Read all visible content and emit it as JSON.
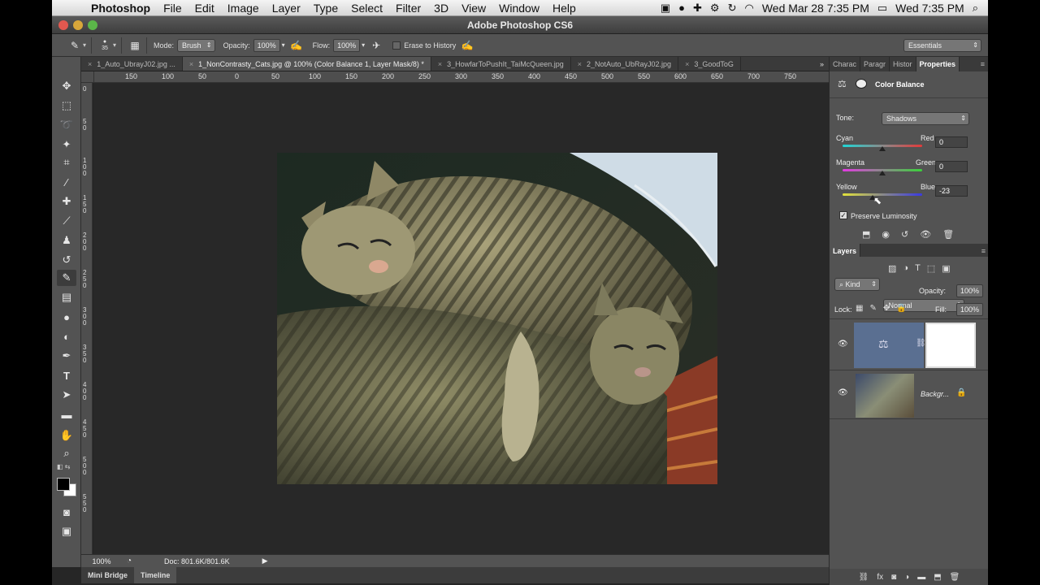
{
  "menubar": {
    "app": "Photoshop",
    "items": [
      "File",
      "Edit",
      "Image",
      "Layer",
      "Type",
      "Select",
      "Filter",
      "3D",
      "View",
      "Window",
      "Help"
    ],
    "date_time": "Wed Mar 28  7:35 PM",
    "date_time_2": "Wed 7:35 PM"
  },
  "window": {
    "title": "Adobe Photoshop CS6"
  },
  "options": {
    "brush_size": "35",
    "mode_label": "Mode:",
    "mode_value": "Brush",
    "opacity_label": "Opacity:",
    "opacity_value": "100%",
    "flow_label": "Flow:",
    "flow_value": "100%",
    "erase_history": "Erase to History",
    "workspace": "Essentials"
  },
  "tabs": [
    {
      "label": "1_Auto_UbrayJ02.jpg ..."
    },
    {
      "label": "1_NonContrasty_Cats.jpg @ 100% (Color Balance 1, Layer Mask/8) *"
    },
    {
      "label": "3_HowfarToPushIt_TaiMcQueen.jpg"
    },
    {
      "label": "2_NotAuto_UbRayJ02.jpg"
    },
    {
      "label": "3_GoodToG"
    }
  ],
  "ruler": {
    "h_ticks": [
      "150",
      "100",
      "50",
      "0",
      "50",
      "100",
      "150",
      "200",
      "250",
      "300",
      "350",
      "400",
      "450",
      "500",
      "550",
      "600",
      "650",
      "700",
      "750"
    ],
    "v_ticks": [
      "0",
      "5 0",
      "1 0 0",
      "1 5 0",
      "2 0 0",
      "2 5 0",
      "3 0 0",
      "3 5 0",
      "4 0 0",
      "4 5 0",
      "5 0 0",
      "5 5 0"
    ]
  },
  "status": {
    "zoom": "100%",
    "doc": "Doc: 801.6K/801.6K"
  },
  "bottom_tabs": [
    "Mini Bridge",
    "Timeline"
  ],
  "panel_tabs": [
    "Charac",
    "Paragr",
    "Histor",
    "Properties"
  ],
  "properties": {
    "title": "Color Balance",
    "tone_label": "Tone:",
    "tone_value": "Shadows",
    "sliders": [
      {
        "left": "Cyan",
        "right": "Red",
        "value": "0",
        "position": 0.5
      },
      {
        "left": "Magenta",
        "right": "Green",
        "value": "0",
        "position": 0.5
      },
      {
        "left": "Yellow",
        "right": "Blue",
        "value": "-23",
        "position": 0.38
      }
    ],
    "preserve": "Preserve Luminosity"
  },
  "layers": {
    "title": "Layers",
    "kind": "Kind",
    "blend": "Normal",
    "opacity_label": "Opacity:",
    "opacity_value": "100%",
    "lock_label": "Lock:",
    "fill_label": "Fill:",
    "fill_value": "100%",
    "background_name": "Backgr..."
  },
  "colors": {
    "accent": "#5a6f91",
    "panel": "#535353",
    "canvas": "#282828"
  }
}
